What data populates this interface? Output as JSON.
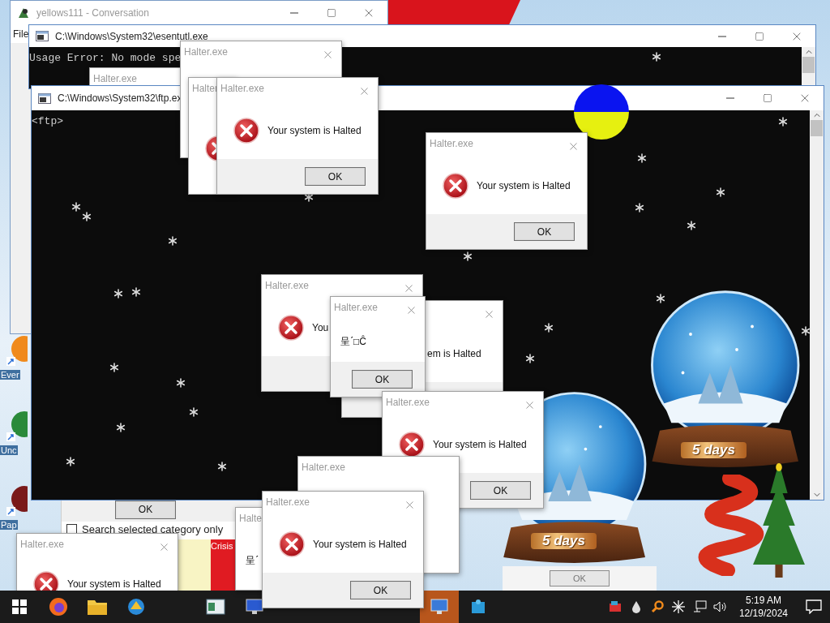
{
  "desktop_icons": [
    {
      "label": "Ever"
    },
    {
      "label": "Unc"
    },
    {
      "label": "Pap"
    }
  ],
  "conversation_window": {
    "title": "yellows111 - Conversation",
    "menu": [
      "File"
    ]
  },
  "console_windows": [
    {
      "title": "C:\\Windows\\System32\\esentutl.exe",
      "output": "Usage Error: No mode spe"
    },
    {
      "title": "C:\\Windows\\System32\\ftp.ex",
      "output": "<ftp>"
    }
  ],
  "back_window": {
    "button": "OK",
    "checkbox": {
      "label": "Search selected category only",
      "checked": false
    },
    "tag": "Crisis"
  },
  "background_button": "OK",
  "widgets": [
    {
      "label": "5 days"
    },
    {
      "label": "5 days"
    }
  ],
  "dialogs": [
    {
      "title": "Halter.exe",
      "kind": "plain"
    },
    {
      "title": "Halter.exe",
      "kind": "plain"
    },
    {
      "title": "Halter",
      "kind": "error"
    },
    {
      "title": "Halter.exe",
      "kind": "error",
      "message": "Your system is Halted",
      "button": "OK"
    },
    {
      "title": "Halter.exe",
      "kind": "error",
      "message": "Your system is Halted",
      "button": "OK"
    },
    {
      "title": "Halter.exe",
      "kind": "error",
      "message": "You"
    },
    {
      "kind": "plain",
      "message": "em is Halted"
    },
    {
      "title": "Halter.exe",
      "kind": "plain",
      "message": "呈ˊ□Ĉ",
      "button": "OK"
    },
    {
      "title": "Halter.exe",
      "kind": "error",
      "message": "Your system is Halted",
      "button": "OK"
    },
    {
      "title": "Halter.exe",
      "kind": "error",
      "message": "Your system is Halted"
    },
    {
      "title": "Halte",
      "kind": "plain",
      "message": "呈ˊ"
    },
    {
      "title": "Halter.exe",
      "kind": "plain"
    },
    {
      "title": "Halter.exe",
      "kind": "error",
      "message": "Your system is Halted",
      "button": "OK"
    }
  ],
  "taskbar": {
    "time": "5:19 AM",
    "date": "12/19/2024"
  }
}
